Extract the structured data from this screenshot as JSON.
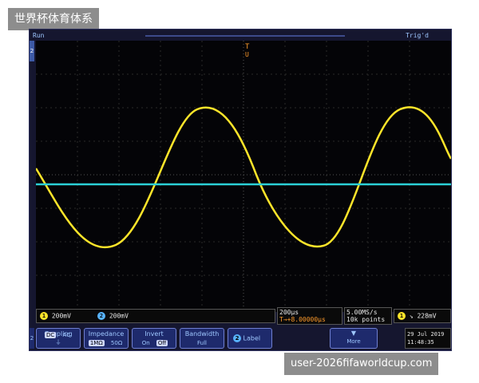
{
  "overlay": {
    "top_left_text": "世界杯体育体系",
    "bottom_right_text": "user-2026fifaworldcup.com"
  },
  "status": {
    "run": "Run",
    "trig": "Trig'd"
  },
  "markers": {
    "trigger_position_top": "T",
    "trigger_position_bottom": "U",
    "channel_ground_left": "2"
  },
  "readouts": {
    "ch1": {
      "badge": "1",
      "text": "200mV"
    },
    "ch2": {
      "badge": "2",
      "text": "200mV"
    },
    "timebase": {
      "line1": "200µs",
      "line2": "T→+8.00000µs"
    },
    "sample": {
      "line1": "5.00MS/s",
      "line2": "10k points"
    },
    "trigger": {
      "badge": "1",
      "slope_icon": "falling-edge-icon",
      "level": "228mV"
    }
  },
  "menu": {
    "channel_indicator": "2",
    "coupling": {
      "title": "Coupling",
      "options": [
        "DC",
        "AC",
        "⏚"
      ],
      "selected": "DC"
    },
    "impedance": {
      "title": "Impedance",
      "options": [
        "1MΩ",
        "50Ω"
      ],
      "selected": "1MΩ"
    },
    "invert": {
      "title": "Invert",
      "options": [
        "On",
        "Off"
      ],
      "selected": "Off"
    },
    "bandwidth": {
      "title": "Bandwidth",
      "value": "Full"
    },
    "label": {
      "badge": "2",
      "text": "Label"
    },
    "more": {
      "label": "More",
      "arrow": "▼"
    },
    "datetime": {
      "date": "29 Jul 2019",
      "time": "11:48:35"
    }
  },
  "colors": {
    "ch1": "#ffe52a",
    "ch2": "#2bd0d6",
    "grid": "#3a3a3a"
  }
}
